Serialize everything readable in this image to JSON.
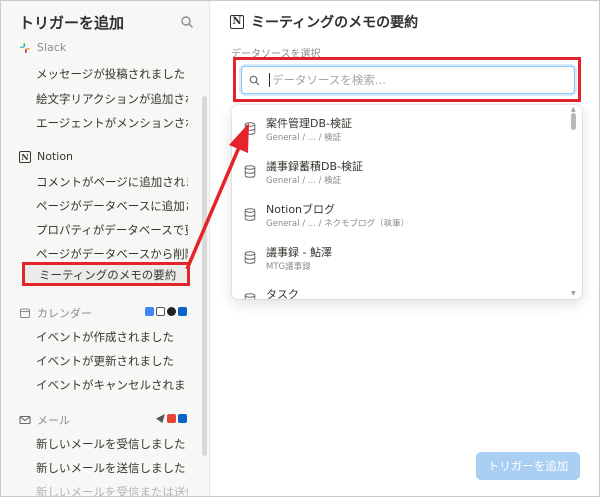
{
  "sidebar": {
    "title": "トリガーを追加",
    "sections": [
      {
        "name": "Slack",
        "items": [
          "メッセージが投稿されました",
          "絵文字リアクションが追加され",
          "エージェントがメンションされ"
        ]
      },
      {
        "name": "Notion",
        "items": [
          "コメントがページに追加されま",
          "ページがデータベースに追加さ",
          "プロパティがデータベースで更",
          "ページがデータベースから削除",
          "ミーティングのメモの要約"
        ]
      },
      {
        "name": "カレンダー",
        "items": [
          "イベントが作成されました",
          "イベントが更新されました",
          "イベントがキャンセルされまし"
        ]
      },
      {
        "name": "メール",
        "items": [
          "新しいメールを受信しました",
          "新しいメールを送信しました",
          "新しいメールを受信または送信"
        ]
      }
    ]
  },
  "main": {
    "title": "ミーティングのメモの要約",
    "datasource_label": "データソースを選択",
    "search_placeholder": "データソースを検索...",
    "results": [
      {
        "name": "案件管理DB-検証",
        "path": "General / ... / 検証"
      },
      {
        "name": "議事録蓄積DB-検証",
        "path": "General / ... / 検証"
      },
      {
        "name": "Notionブログ",
        "path": "General / ... / ネクモブログ（執筆）"
      },
      {
        "name": "議事録 - 鮎澤",
        "path": "MTG議事録"
      },
      {
        "name": "タスク",
        "path": ""
      }
    ],
    "add_button": "トリガーを追加"
  },
  "colors": {
    "highlight": "#e5232a",
    "button": "#a9cff2",
    "sidebar_bg": "#f7f7f5"
  }
}
